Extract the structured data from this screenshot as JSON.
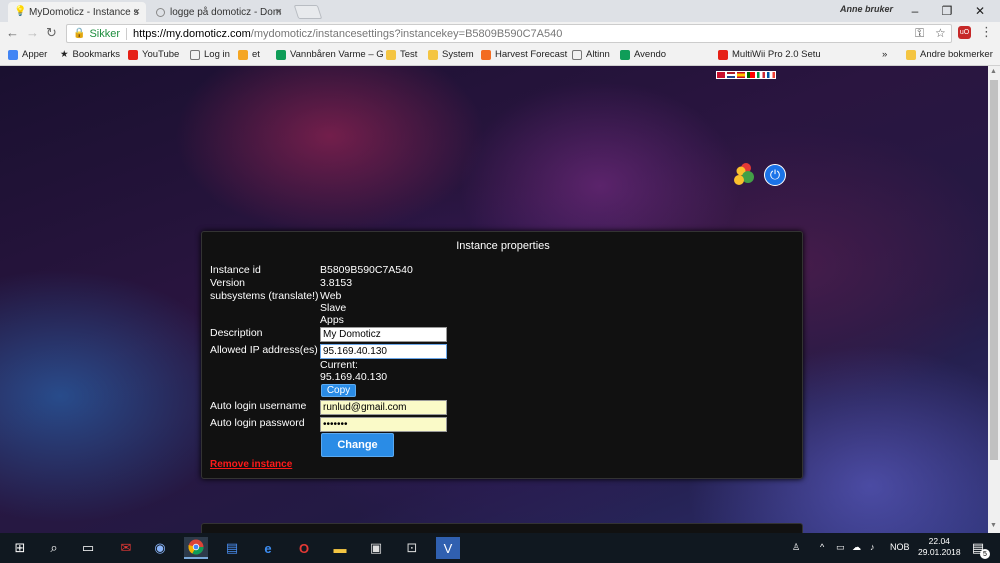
{
  "browser": {
    "tabs": [
      {
        "title": "MyDomoticz - Instance s"
      },
      {
        "title": "logge på domoticz - Dom"
      }
    ],
    "user_label": "Anne bruker",
    "address": {
      "secure_label": "Sikker",
      "url_host": "https://my.domoticz.com",
      "url_rest": "/mydomoticz/instancesettings?instancekey=B5809B590C7A540"
    },
    "bookmarks": [
      {
        "label": "Apper",
        "color": "#4285f4"
      },
      {
        "label": "Bookmarks",
        "color": "#555555"
      },
      {
        "label": "YouTube",
        "color": "#e62117"
      },
      {
        "label": "Log in",
        "color": "#777777"
      },
      {
        "label": "et",
        "color": "#f5a623"
      },
      {
        "label": "Vannbåren Varme – G",
        "color": "#0f9d58"
      },
      {
        "label": "Test",
        "color": "#f4c542"
      },
      {
        "label": "System",
        "color": "#f4c542"
      },
      {
        "label": "Harvest Forecast",
        "color": "#f36c21"
      },
      {
        "label": "Altinn",
        "color": "#777777"
      },
      {
        "label": "Avendo",
        "color": "#f4c542"
      },
      {
        "label": "MultiWii Pro 2.0 Setu",
        "color": "#e62117"
      }
    ],
    "other_bookmarks": "Andre bokmerker"
  },
  "panel": {
    "title": "Instance properties",
    "instance_id_label": "Instance id",
    "instance_id": "B5809B590C7A540",
    "version_label": "Version",
    "version": "3.8153",
    "subsystems_label": "subsystems (translate!)",
    "subsystems": [
      "Web",
      "Slave",
      "Apps"
    ],
    "description_label": "Description",
    "description": "My Domoticz",
    "allowed_ip_label": "Allowed IP address(es)",
    "allowed_ip": "95.169.40.130",
    "current_label": "Current:",
    "current_ip": "95.169.40.130",
    "copy_label": "Copy",
    "auto_user_label": "Auto login username",
    "auto_user": "runlud@gmail.com",
    "auto_pass_label": "Auto login password",
    "auto_pass": "•••••••",
    "change_label": "Change",
    "remove_label": "Remove instance"
  },
  "taskbar": {
    "lang": "NOB",
    "time": "22.04",
    "date": "29.01.2018",
    "notif_count": "5"
  }
}
